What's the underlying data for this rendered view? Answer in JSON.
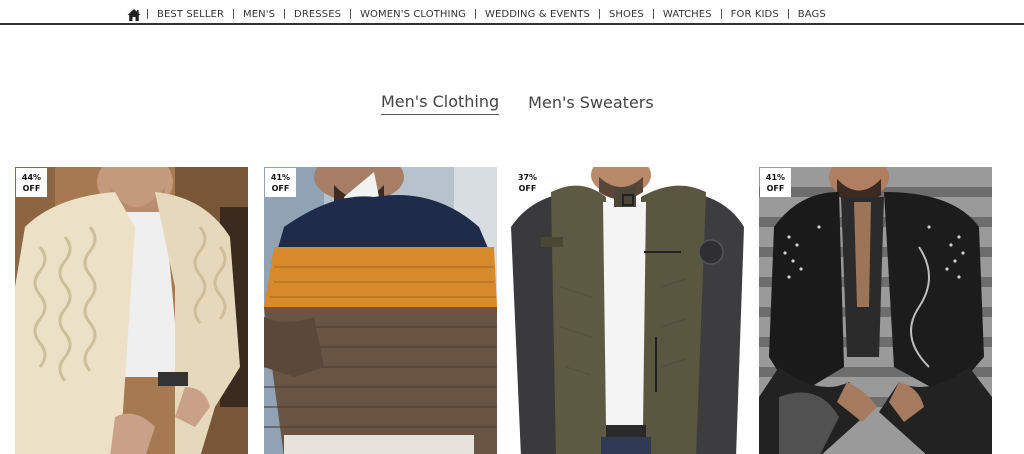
{
  "nav": {
    "home_icon": "home-icon",
    "items": [
      "BEST SELLER",
      "MEN'S",
      "DRESSES",
      "WOMEN'S CLOTHING",
      "WEDDING & EVENTS",
      "SHOES",
      "WATCHES",
      "FOR KIDS",
      "BAGS"
    ]
  },
  "tabs": [
    {
      "label": "Men's Clothing",
      "active": true
    },
    {
      "label": "Men's Sweaters",
      "active": false
    }
  ],
  "products": [
    {
      "discount": "44%",
      "off": "OFF",
      "image": "cream cable-knit cardigan"
    },
    {
      "discount": "41%",
      "off": "OFF",
      "image": "navy, orange and brown striped knit sweater"
    },
    {
      "discount": "37%",
      "off": "OFF",
      "image": "olive vest with black leather sleeves jacket"
    },
    {
      "discount": "41%",
      "off": "OFF",
      "image": "black studded leather biker jacket"
    }
  ],
  "colors": {
    "nav_border": "#333333",
    "text": "#333333",
    "badge_bg": "#ffffff"
  }
}
